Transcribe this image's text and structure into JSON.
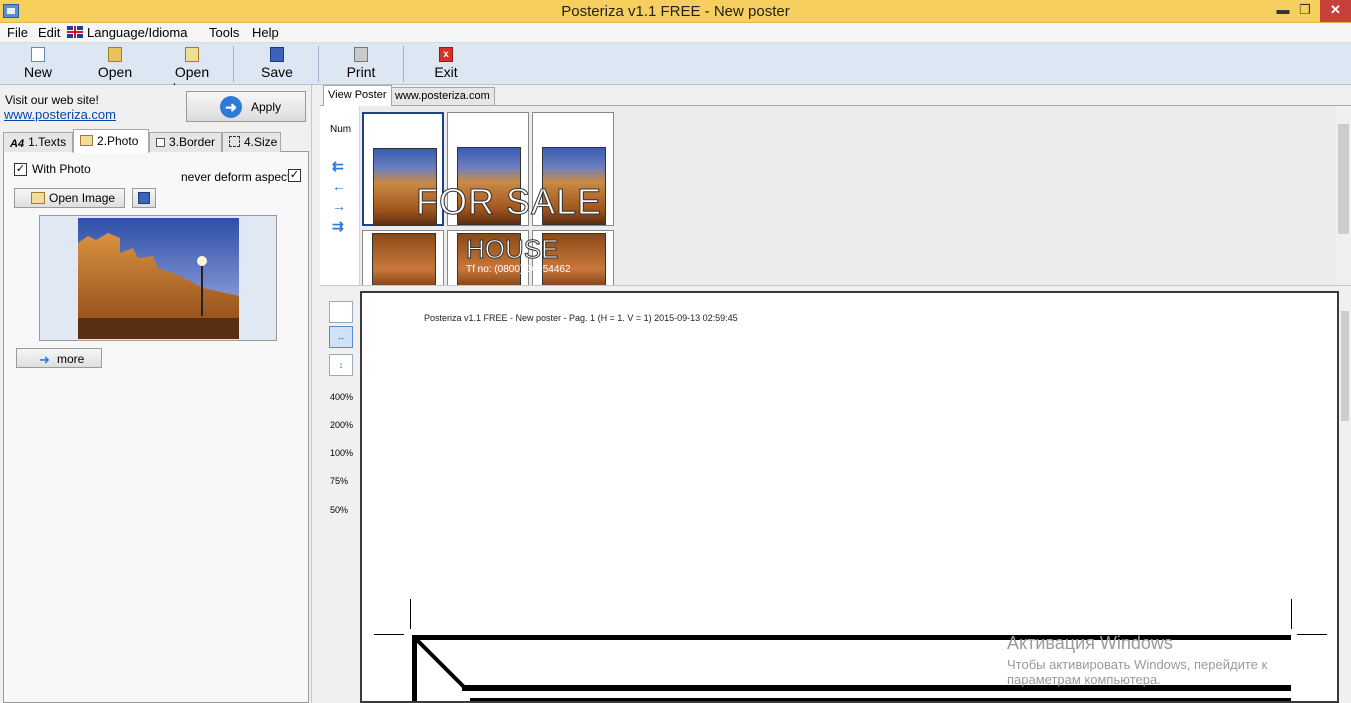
{
  "window": {
    "title": "Posteriza v1.1 FREE - New poster",
    "min_glyph": "▬",
    "max_glyph": "❐",
    "close_glyph": "✕"
  },
  "menu": {
    "file": "File",
    "edit": "Edit",
    "language": "Language/Idioma",
    "tools": "Tools",
    "help": "Help"
  },
  "toolbar": {
    "new": "New",
    "open": "Open",
    "open_image": "Open Image",
    "save": "Save",
    "print": "Print",
    "exit": "Exit",
    "exit_icon_glyph": "x"
  },
  "left": {
    "visit_label": "Visit our web site!",
    "visit_link": "www.posteriza.com",
    "apply": "Apply",
    "apply_glyph": "➜",
    "tabs": [
      {
        "label": "1.Texts",
        "icon": "A4"
      },
      {
        "label": "2.Photo"
      },
      {
        "label": "3.Border"
      },
      {
        "label": "4.Size"
      }
    ],
    "with_photo": "With Photo",
    "with_photo_checked": "✓",
    "never_deform": "never deform aspect",
    "never_deform_checked": "✓",
    "open_image": "Open Image",
    "more": "more",
    "more_glyph": "➜"
  },
  "right": {
    "tabs": [
      "View Poster",
      "www.posteriza.com"
    ],
    "num_label": "Num",
    "nav_glyphs": [
      "⇇",
      "←",
      "→",
      "⇉"
    ],
    "poster_text": "FOR SALE",
    "house_text": "HOUSE",
    "phone_text": "Tf no: (0800) 66954462",
    "zoom_levels": [
      "400%",
      "200%",
      "100%",
      "75%",
      "50%"
    ],
    "page_header": "Posteriza v1.1 FREE - New poster - Pag. 1 (H = 1. V = 1) 2015-09-13  02:59:45"
  },
  "watermark": {
    "title": "Активация Windows",
    "subtitle": "Чтобы активировать Windows, перейдите к параметрам компьютера."
  },
  "colors": {
    "titlebar": "#f6cf5e",
    "toolbar": "#dde7f3",
    "link": "#0645ad",
    "accent": "#2d7bd6"
  }
}
